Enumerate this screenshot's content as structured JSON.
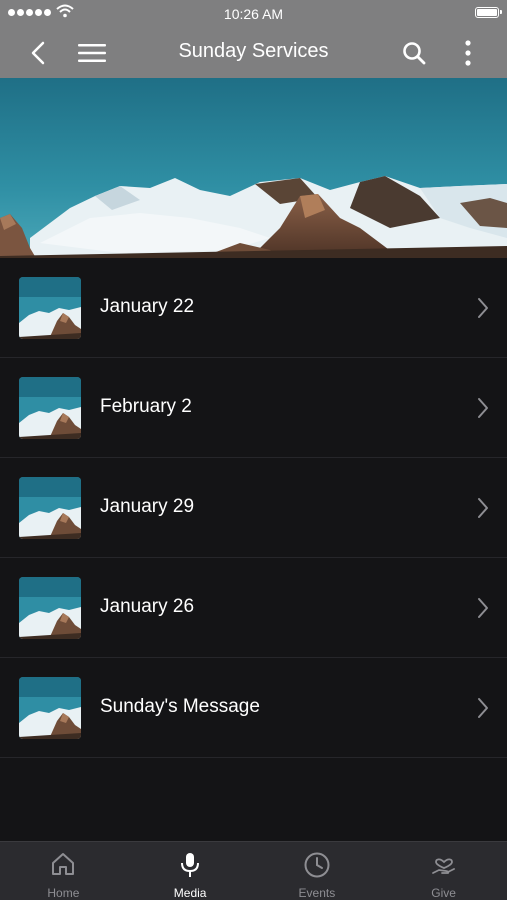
{
  "status_bar": {
    "time": "10:26 AM"
  },
  "navbar": {
    "title": "Sunday Services",
    "icons": [
      "back-chevron-icon",
      "menu-icon",
      "search-icon",
      "more-vertical-icon"
    ]
  },
  "hero": {
    "icon": "mountain-photo"
  },
  "list": {
    "items": [
      {
        "label": "January 22"
      },
      {
        "label": "February 2"
      },
      {
        "label": "January 29"
      },
      {
        "label": "January 26"
      },
      {
        "label": "Sunday's Message"
      }
    ]
  },
  "tabbar": {
    "tabs": [
      {
        "label": "Home",
        "icon": "home-icon"
      },
      {
        "label": "Media",
        "icon": "microphone-icon"
      },
      {
        "label": "Events",
        "icon": "clock-icon"
      },
      {
        "label": "Give",
        "icon": "giving-hand-icon"
      }
    ],
    "active": "Media"
  },
  "colors": {
    "header": "#7f7f80",
    "background": "#141416",
    "tabbar": "#2b2b2f"
  }
}
